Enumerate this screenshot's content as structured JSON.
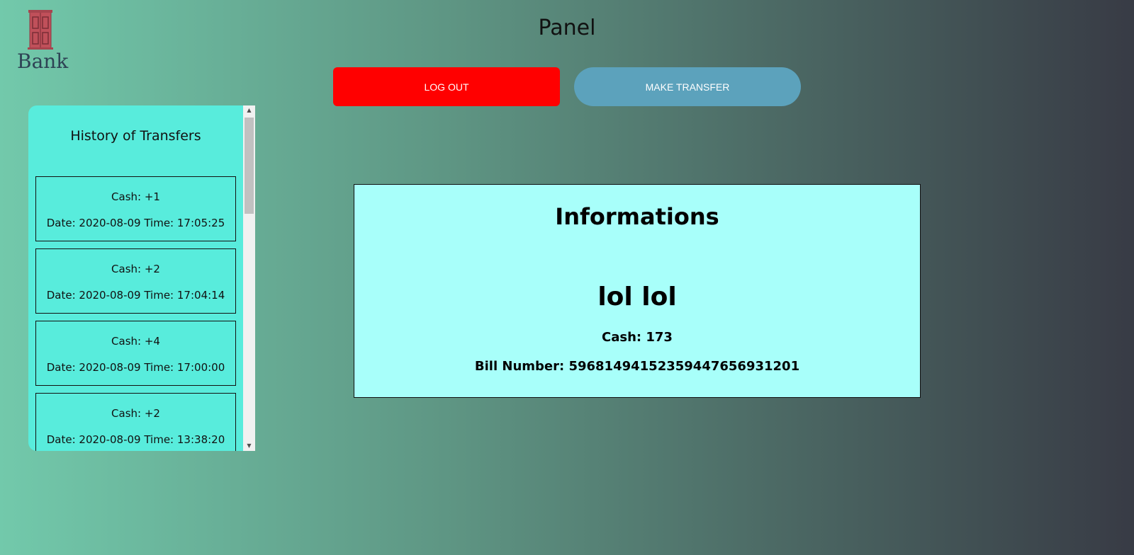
{
  "logo": {
    "text": "Bank",
    "icon": "bank-door-icon",
    "color": "#c0505a"
  },
  "page_title": "Panel",
  "buttons": {
    "logout_label": "LOG OUT",
    "transfer_label": "MAKE TRANSFER"
  },
  "history": {
    "title": "History of Transfers",
    "items": [
      {
        "cash": "Cash: +1",
        "datetime": "Date: 2020-08-09 Time: 17:05:25"
      },
      {
        "cash": "Cash: +2",
        "datetime": "Date: 2020-08-09 Time: 17:04:14"
      },
      {
        "cash": "Cash: +4",
        "datetime": "Date: 2020-08-09 Time: 17:00:00"
      },
      {
        "cash": "Cash: +2",
        "datetime": "Date: 2020-08-09 Time: 13:38:20"
      }
    ]
  },
  "info": {
    "heading": "Informations",
    "name": "lol lol",
    "cash": "Cash: 173",
    "bill_number": "Bill Number: 59681494152359447656931201"
  },
  "colors": {
    "logout": "#ff0000",
    "transfer": "#5ca2bc",
    "history_bg": "#58ecdc",
    "info_bg": "#a8fffa"
  }
}
